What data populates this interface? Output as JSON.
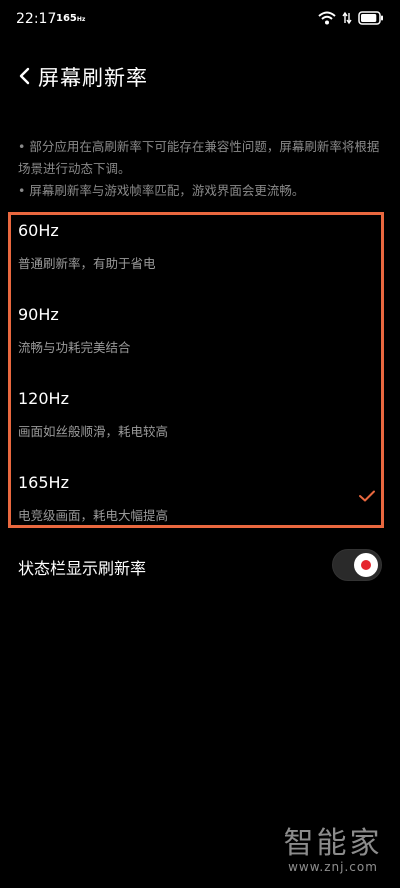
{
  "status_bar": {
    "time": "22:17",
    "refresh_badge": "165",
    "refresh_badge_unit": "Hz",
    "battery_level": 0.9
  },
  "header": {
    "title": "屏幕刷新率"
  },
  "notes": [
    "• 部分应用在高刷新率下可能存在兼容性问题，屏幕刷新率将根据场景进行动态下调。",
    "• 屏幕刷新率与游戏帧率匹配，游戏界面会更流畅。"
  ],
  "rates": [
    {
      "label": "60Hz",
      "desc": "普通刷新率，有助于省电",
      "selected": false
    },
    {
      "label": "90Hz",
      "desc": "流畅与功耗完美结合",
      "selected": false
    },
    {
      "label": "120Hz",
      "desc": "画面如丝般顺滑，耗电较高",
      "selected": false
    },
    {
      "label": "165Hz",
      "desc": "电竞级画面，耗电大幅提高",
      "selected": true
    }
  ],
  "toggle": {
    "label": "状态栏显示刷新率",
    "on": true
  },
  "watermark": {
    "brand": "智能家",
    "url": "www.znj.com"
  },
  "colors": {
    "highlight_border": "#e9683f",
    "check": "#e9683f",
    "toggle_dot": "#e5252d"
  }
}
